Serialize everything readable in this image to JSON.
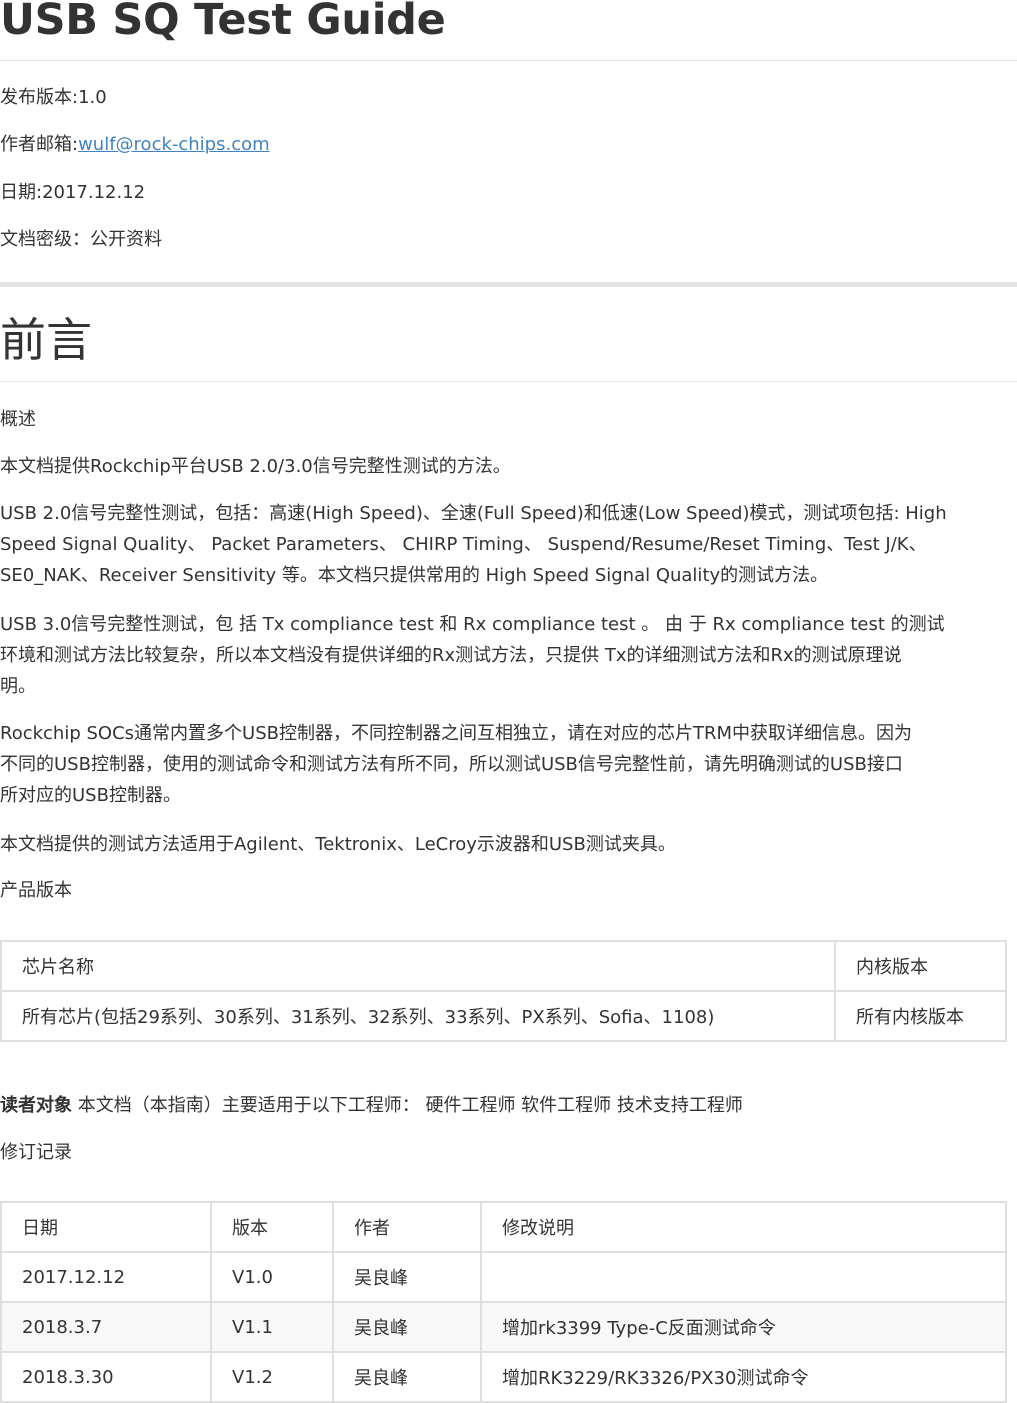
{
  "title": "USB SQ Test Guide",
  "meta": {
    "version_line": "发布版本:1.0",
    "email_label": "作者邮箱:",
    "email": "wulf@rock-chips.com",
    "date_line": "日期:2017.12.12",
    "security_line": "文档密级：公开资料"
  },
  "section_title": "前言",
  "overview": {
    "heading": "概述",
    "p1": "本文档提供Rockchip平台USB 2.0/3.0信号完整性测试的方法。",
    "p2_lines": [
      "USB 2.0信号完整性测试，包括：高速(High Speed)、全速(Full Speed)和低速(Low Speed)模式，测试项包括: High",
      "Speed Signal Quality、 Packet Parameters、 CHIRP Timing、 Suspend/Resume/Reset Timing、Test J/K、",
      "SE0_NAK、Receiver Sensitivity 等。本文档只提供常用的 High Speed Signal Quality的测试方法。"
    ],
    "p3_lines": [
      "USB 3.0信号完整性测试，包 括 Tx compliance test 和 Rx compliance test 。 由 于 Rx compliance test 的测试",
      "环境和测试方法比较复杂，所以本文档没有提供详细的Rx测试方法，只提供 Tx的详细测试方法和Rx的测试原理说",
      "明。"
    ],
    "p4_lines": [
      "Rockchip SOCs通常内置多个USB控制器，不同控制器之间互相独立，请在对应的芯片TRM中获取详细信息。因为",
      "不同的USB控制器，使用的测试命令和测试方法有所不同，所以测试USB信号完整性前，请先明确测试的USB接口",
      "所对应的USB控制器。"
    ],
    "p5": "本文档提供的测试方法适用于Agilent、Tektronix、LeCroy示波器和USB测试夹具。"
  },
  "product_version": {
    "heading": "产品版本",
    "columns": [
      "芯片名称",
      "内核版本"
    ],
    "rows": [
      [
        "所有芯片(包括29系列、30系列、31系列、32系列、33系列、PX系列、Sofia、1108)",
        "所有内核版本"
      ]
    ]
  },
  "audience": {
    "label": "读者对象",
    "text": " 本文档（本指南）主要适用于以下工程师： 硬件工程师 软件工程师 技术支持工程师"
  },
  "revision": {
    "heading": "修订记录",
    "columns": [
      "日期",
      "版本",
      "作者",
      "修改说明"
    ],
    "rows": [
      [
        "2017.12.12",
        "V1.0",
        "吴良峰",
        ""
      ],
      [
        "2018.3.7",
        "V1.1",
        "吴良峰",
        "增加rk3399 Type-C反面测试命令"
      ],
      [
        "2018.3.30",
        "V1.2",
        "吴良峰",
        "增加RK3229/RK3326/PX30测试命令"
      ]
    ]
  }
}
